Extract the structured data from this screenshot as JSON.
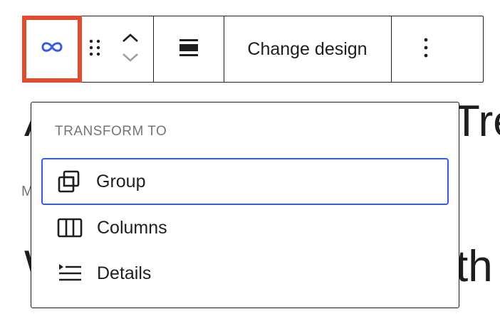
{
  "background": {
    "heading1_left": "A",
    "heading1_right": "Tre",
    "meta_text": "M",
    "heading2_left": "W",
    "heading2_right": "th"
  },
  "toolbar": {
    "block_type_icon": "link-icon",
    "drag_icon": "drag-handle-icon",
    "move_up_icon": "chevron-up-icon",
    "move_down_icon": "chevron-down-icon",
    "align_icon": "align-icon",
    "change_design_label": "Change design",
    "more_icon": "more-vertical-icon",
    "highlight_color": "#e34b2e",
    "icon_color": "#3858e9"
  },
  "dropdown": {
    "title": "TRANSFORM TO",
    "focus_color": "#3858e9",
    "items": [
      {
        "label": "Group",
        "icon": "group-icon"
      },
      {
        "label": "Columns",
        "icon": "columns-icon"
      },
      {
        "label": "Details",
        "icon": "details-icon"
      }
    ]
  }
}
